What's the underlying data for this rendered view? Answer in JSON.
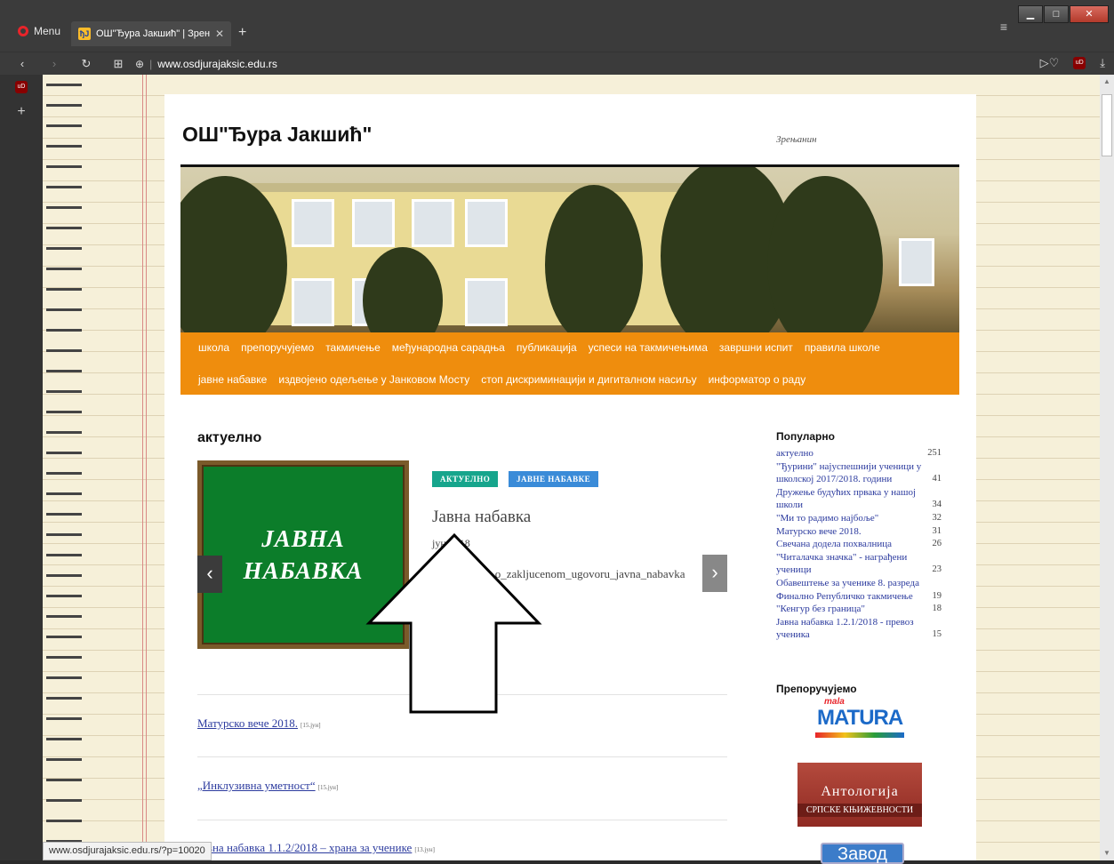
{
  "browser": {
    "menu_label": "Menu",
    "tab_title": "ОШ\"Ђура Јакшић\" | Зрен",
    "tab_favicon": "ђЈ",
    "url_host": "www.osdjurajaksic.edu.rs",
    "ublock_label": "uD",
    "status_url": "www.osdjurajaksic.edu.rs/?p=10020"
  },
  "site": {
    "title": "ОШ\"Ђура Јакшић\"",
    "tagline": "Зрењанин",
    "accent_color": "#ef8d0d",
    "menu_row1": [
      "школа",
      "препоручујемо",
      "такмичење",
      "међународна сарадња",
      "публикација",
      "успеси на такмичењима",
      "завршни испит",
      "правила школе"
    ],
    "menu_row2": [
      "јавне набавке",
      "издвојено одељење у Јанковом Мосту",
      "стоп дискриминацији и дигиталном насиљу",
      "информатор о раду"
    ]
  },
  "main": {
    "section_title": "актуелно",
    "board_line1": "ЈАВНА",
    "board_line2": "НАБАВКА",
    "badge1": "АКТУЕЛНО",
    "badge2": "ЈАВНЕ НАБАВКЕ",
    "post_title": "Јавна набавка",
    "post_date": "јун 2018",
    "post_file": "Obavestenje_o_zakljucenom_ugovoru_javna_nabavka",
    "posts": [
      {
        "title": "Матурско вече 2018.",
        "date": "[15.јун]"
      },
      {
        "title": "„Инклузивна уметност“",
        "date": "[15.јун]"
      },
      {
        "title": "Јавна набавка 1.1.2/2018 – храна за ученике",
        "date": "[13.јун]"
      }
    ]
  },
  "sidebar": {
    "popular_title": "Популарно",
    "popular": [
      {
        "t": "актуелно",
        "n": "251"
      },
      {
        "t": "\"Ђурини\" најуспешнији ученици у школској 2017/2018. години",
        "n": "41"
      },
      {
        "t": "Дружење будућих првака у нашој школи",
        "n": "34"
      },
      {
        "t": "\"Ми то радимо најбоље\"",
        "n": "32"
      },
      {
        "t": "Матурско вече 2018.",
        "n": "31"
      },
      {
        "t": "Свечана додела похвалница",
        "n": "26"
      },
      {
        "t": "\"Читалачка значка\" - награђени ученици",
        "n": "23"
      },
      {
        "t": "Обавештење за ученике 8. разреда",
        "n": ""
      },
      {
        "t": "Финално Републичко такмичење",
        "n": "19"
      },
      {
        "t": "\"Кенгур без граница\"",
        "n": "18"
      },
      {
        "t": "Јавна набавка 1.2.1/2018 - превоз ученика",
        "n": "15"
      }
    ],
    "recommend_title": "Препоручујемо",
    "matura_small": "mala",
    "matura_big": "MATURA",
    "antol_line1": "Антологија",
    "antol_line2": "српске књижевности",
    "zavod": "Завод"
  }
}
